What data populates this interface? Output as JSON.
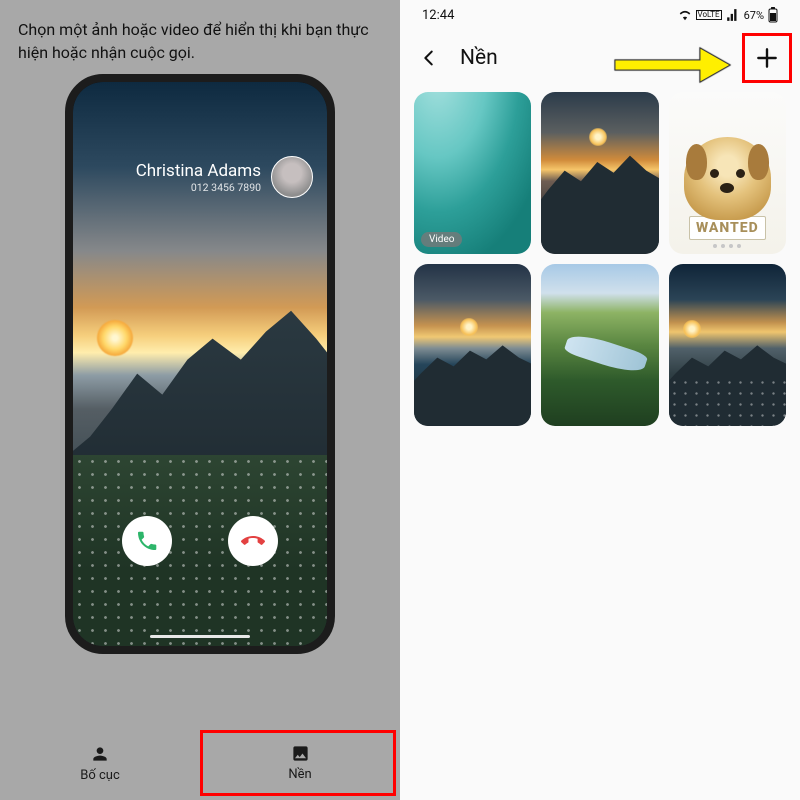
{
  "left": {
    "instruction": "Chọn một ảnh hoặc video để hiển thị khi bạn thực hiện hoặc nhận cuộc gọi.",
    "caller_name": "Christina Adams",
    "caller_number": "012 3456 7890",
    "tabs": {
      "layout": "Bố cục",
      "background": "Nền"
    }
  },
  "right": {
    "status": {
      "time": "12:44",
      "battery": "67%"
    },
    "title": "Nền",
    "grid": {
      "video_badge": "Video",
      "wanted_text": "WANTED"
    }
  }
}
